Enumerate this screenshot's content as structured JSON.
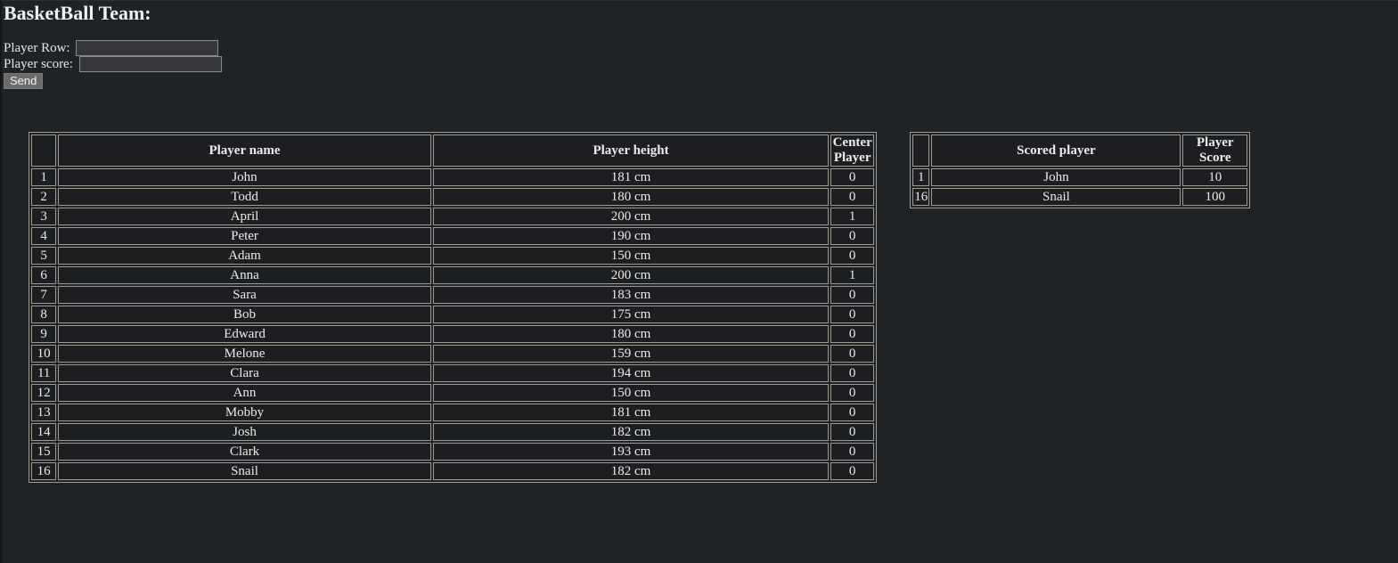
{
  "page_title": "BasketBall Team:",
  "form": {
    "row_label": "Player Row: ",
    "row_value": "",
    "score_label": "Player score: ",
    "score_value": "",
    "send_label": "Send"
  },
  "players_table": {
    "headers": [
      "",
      "Player name",
      "Player height",
      "Center Player"
    ],
    "rows": [
      [
        "1",
        "John",
        "181 cm",
        "0"
      ],
      [
        "2",
        "Todd",
        "180 cm",
        "0"
      ],
      [
        "3",
        "April",
        "200 cm",
        "1"
      ],
      [
        "4",
        "Peter",
        "190 cm",
        "0"
      ],
      [
        "5",
        "Adam",
        "150 cm",
        "0"
      ],
      [
        "6",
        "Anna",
        "200 cm",
        "1"
      ],
      [
        "7",
        "Sara",
        "183 cm",
        "0"
      ],
      [
        "8",
        "Bob",
        "175 cm",
        "0"
      ],
      [
        "9",
        "Edward",
        "180 cm",
        "0"
      ],
      [
        "10",
        "Melone",
        "159 cm",
        "0"
      ],
      [
        "11",
        "Clara",
        "194 cm",
        "0"
      ],
      [
        "12",
        "Ann",
        "150 cm",
        "0"
      ],
      [
        "13",
        "Mobby",
        "181 cm",
        "0"
      ],
      [
        "14",
        "Josh",
        "182 cm",
        "0"
      ],
      [
        "15",
        "Clark",
        "193 cm",
        "0"
      ],
      [
        "16",
        "Snail",
        "182 cm",
        "0"
      ]
    ]
  },
  "scores_table": {
    "headers": [
      "",
      "Scored player",
      "Player Score"
    ],
    "rows": [
      [
        "1",
        "John",
        "10"
      ],
      [
        "16",
        "Snail",
        "100"
      ]
    ]
  }
}
